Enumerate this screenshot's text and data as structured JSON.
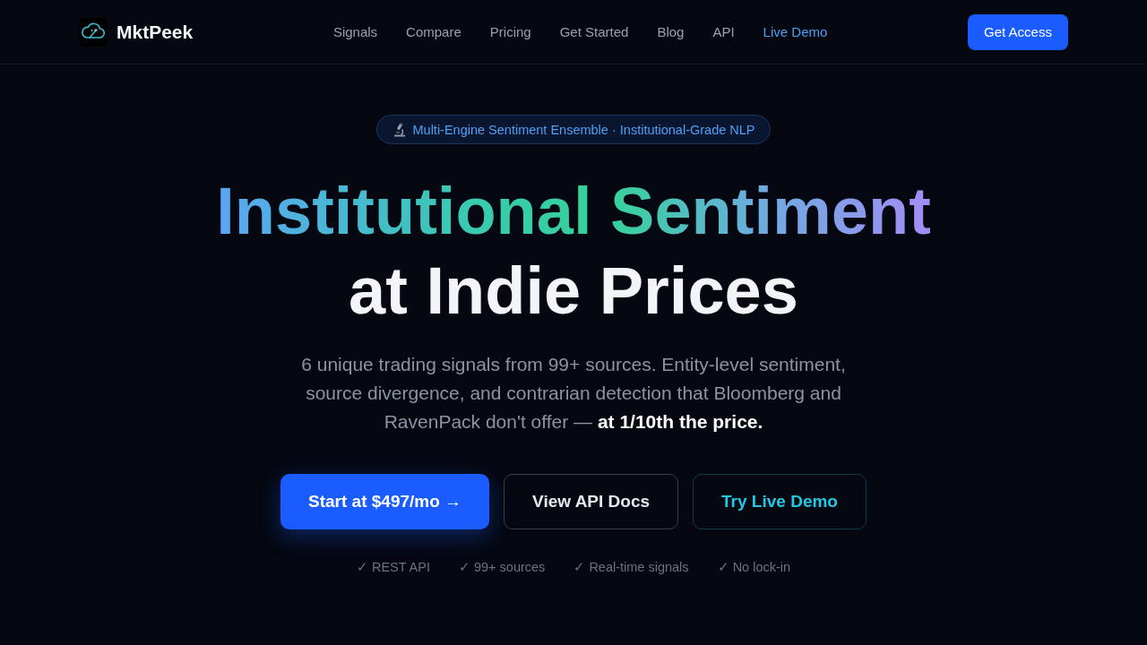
{
  "header": {
    "brand": "MktPeek",
    "nav": [
      {
        "label": "Signals",
        "accent": false
      },
      {
        "label": "Compare",
        "accent": false
      },
      {
        "label": "Pricing",
        "accent": false
      },
      {
        "label": "Get Started",
        "accent": false
      },
      {
        "label": "Blog",
        "accent": false
      },
      {
        "label": "API",
        "accent": false
      },
      {
        "label": "Live Demo",
        "accent": true
      }
    ],
    "cta": "Get Access"
  },
  "hero": {
    "badge": "Multi-Engine Sentiment Ensemble · Institutional-Grade NLP",
    "headline": [
      {
        "text": "Institutional Sentiment",
        "gradient": true
      },
      {
        "text": "at Indie Prices",
        "gradient": false
      }
    ],
    "subtitle": "6 unique trading signals from 99+ sources. Entity-level sentiment, source divergence, and contrarian detection that Bloomberg and RavenPack don't offer — **at 1/10th the price.**",
    "buttons": [
      {
        "label": "Start at $497/mo →",
        "kind": "primary"
      },
      {
        "label": "View API Docs",
        "kind": "secondary"
      },
      {
        "label": "Try Live Demo",
        "kind": "outline"
      }
    ],
    "features": [
      "✓ REST API",
      "✓ 99+ sources",
      "✓ Real-time signals",
      "✓ No lock-in"
    ]
  }
}
